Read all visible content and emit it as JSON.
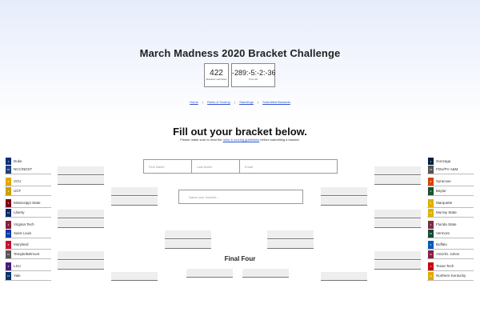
{
  "header": {
    "title": "March Madness 2020 Bracket Challenge",
    "counter_brackets": {
      "value": "422",
      "label": "Brackets submitted"
    },
    "counter_time": {
      "value": "-289:-5:-2:-36",
      "label": "Time left"
    }
  },
  "nav": {
    "home": "Home",
    "rules": "Rules & Scoring",
    "standings": "Standings",
    "submitted": "Submitted Brackets",
    "separator": "|"
  },
  "form": {
    "heading": "Fill out your bracket below.",
    "note_prefix": "Please make sure to read the ",
    "note_link": "rules & scoring guidelines",
    "note_suffix": " before submitting a bracket.",
    "first_name_placeholder": "First Name",
    "last_name_placeholder": "Last Name",
    "email_placeholder": "Email",
    "bracket_name_placeholder": "Name your bracket..."
  },
  "final_four": {
    "label": "Final Four"
  },
  "left_region": [
    {
      "seed": "1",
      "name": "Duke",
      "color": "#0b2f7a"
    },
    {
      "seed": "16",
      "name": "NCC/NDST",
      "color": "#1f3f7a"
    },
    {
      "seed": "8",
      "name": "VCU",
      "color": "#e0a800"
    },
    {
      "seed": "9",
      "name": "UCF",
      "color": "#c9a000"
    },
    {
      "seed": "5",
      "name": "Mississippi State",
      "color": "#7a0019"
    },
    {
      "seed": "12",
      "name": "Liberty",
      "color": "#0a2a66"
    },
    {
      "seed": "4",
      "name": "Virginia Tech",
      "color": "#861f41"
    },
    {
      "seed": "13",
      "name": "Saint Louis",
      "color": "#003da5"
    },
    {
      "seed": "6",
      "name": "Maryland",
      "color": "#c8102e"
    },
    {
      "seed": "11",
      "name": "Temple/Belmont",
      "color": "#555555"
    },
    {
      "seed": "3",
      "name": "LSU",
      "color": "#461d7c"
    },
    {
      "seed": "14",
      "name": "Yale",
      "color": "#00356b"
    }
  ],
  "right_region": [
    {
      "seed": "1",
      "name": "Gonzaga",
      "color": "#041e42"
    },
    {
      "seed": "16",
      "name": "FDU/PV A&M",
      "color": "#555555"
    },
    {
      "seed": "8",
      "name": "Syracuse",
      "color": "#d44500"
    },
    {
      "seed": "9",
      "name": "Baylor",
      "color": "#1d4f2e"
    },
    {
      "seed": "5",
      "name": "Marquette",
      "color": "#e0b000"
    },
    {
      "seed": "12",
      "name": "Murray State",
      "color": "#e0b000"
    },
    {
      "seed": "4",
      "name": "Florida State",
      "color": "#782f40"
    },
    {
      "seed": "13",
      "name": "Vermont",
      "color": "#154734"
    },
    {
      "seed": "6",
      "name": "Buffalo",
      "color": "#005bbb"
    },
    {
      "seed": "11",
      "name": "ASU/St. Johns",
      "color": "#8c1d40"
    },
    {
      "seed": "3",
      "name": "Texas Tech",
      "color": "#cc0000"
    },
    {
      "seed": "14",
      "name": "Northern Kentucky",
      "color": "#e0a800"
    }
  ]
}
